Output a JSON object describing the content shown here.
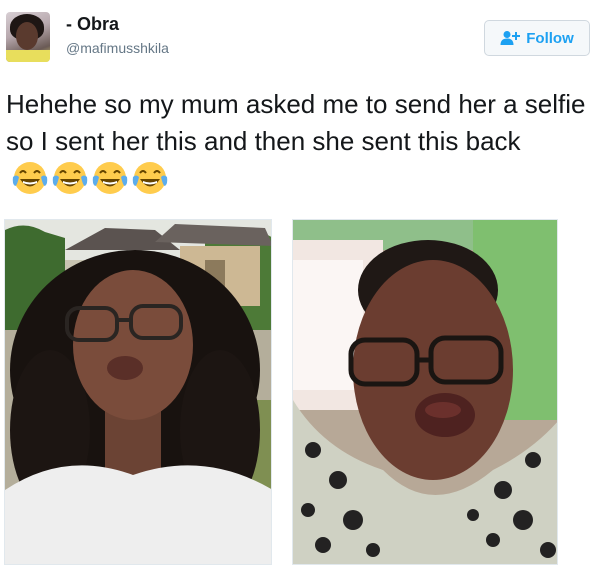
{
  "user": {
    "display_name": "- Obra",
    "handle": "@mafimusshkila"
  },
  "follow_button": {
    "label": "Follow",
    "icon": "add-user-icon",
    "color": "#1da1f2"
  },
  "tweet": {
    "text": "Hehehe so my mum asked me to send her a selfie so I sent her this and then she sent this back",
    "emojis": [
      "face-with-tears-of-joy",
      "face-with-tears-of-joy",
      "face-with-tears-of-joy",
      "face-with-tears-of-joy"
    ]
  },
  "photos": [
    {
      "name": "daughter-selfie"
    },
    {
      "name": "mum-selfie"
    }
  ]
}
